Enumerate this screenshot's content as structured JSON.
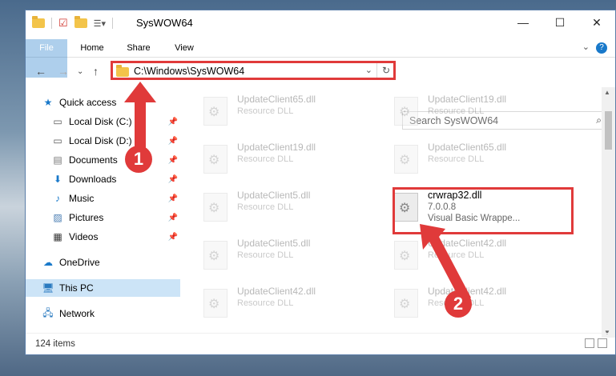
{
  "window": {
    "title": "SysWOW64"
  },
  "controls": {
    "minimize": "—",
    "maximize": "☐",
    "close": "✕"
  },
  "ribbon": {
    "tabs": [
      "File",
      "Home",
      "Share",
      "View"
    ],
    "help": "?"
  },
  "address": {
    "path": "C:\\Windows\\SysWOW64"
  },
  "search": {
    "placeholder": "Search SysWOW64"
  },
  "nav": {
    "items": [
      {
        "label": "Quick access",
        "icon": "star-icon"
      },
      {
        "label": "Local Disk (C:)",
        "icon": "drive-icon"
      },
      {
        "label": "Local Disk (D:)",
        "icon": "drive-icon"
      },
      {
        "label": "Documents",
        "icon": "documents-icon"
      },
      {
        "label": "Downloads",
        "icon": "download-icon"
      },
      {
        "label": "Music",
        "icon": "music-icon"
      },
      {
        "label": "Pictures",
        "icon": "pictures-icon"
      },
      {
        "label": "Videos",
        "icon": "videos-icon"
      },
      {
        "label": "OneDrive",
        "icon": "cloud-icon"
      },
      {
        "label": "This PC",
        "icon": "computer-icon"
      },
      {
        "label": "Network",
        "icon": "network-icon"
      }
    ]
  },
  "files": [
    {
      "name": "UpdateClient65.dll",
      "type": "Resource DLL"
    },
    {
      "name": "UpdateClient19.dll",
      "type": "Resource DLL"
    },
    {
      "name": "UpdateClient19.dll",
      "type": "Resource DLL"
    },
    {
      "name": "UpdateClient65.dll",
      "type": "Resource DLL"
    },
    {
      "name": "UpdateClient5.dll",
      "type": "Resource DLL"
    },
    {
      "name": "crwrap32.dll",
      "type": "7.0.0.8",
      "desc": "Visual Basic Wrappe..."
    },
    {
      "name": "UpdateClient5.dll",
      "type": "Resource DLL"
    },
    {
      "name": "UpdateClient42.dll",
      "type": "Resource DLL"
    },
    {
      "name": "UpdateClient42.dll",
      "type": "Resource DLL"
    },
    {
      "name": "UpdateClient42.dll",
      "type": "Resource DLL"
    }
  ],
  "status": {
    "count": "124 items"
  },
  "annotations": {
    "step1": "1",
    "step2": "2",
    "color": "#e03a3a"
  }
}
